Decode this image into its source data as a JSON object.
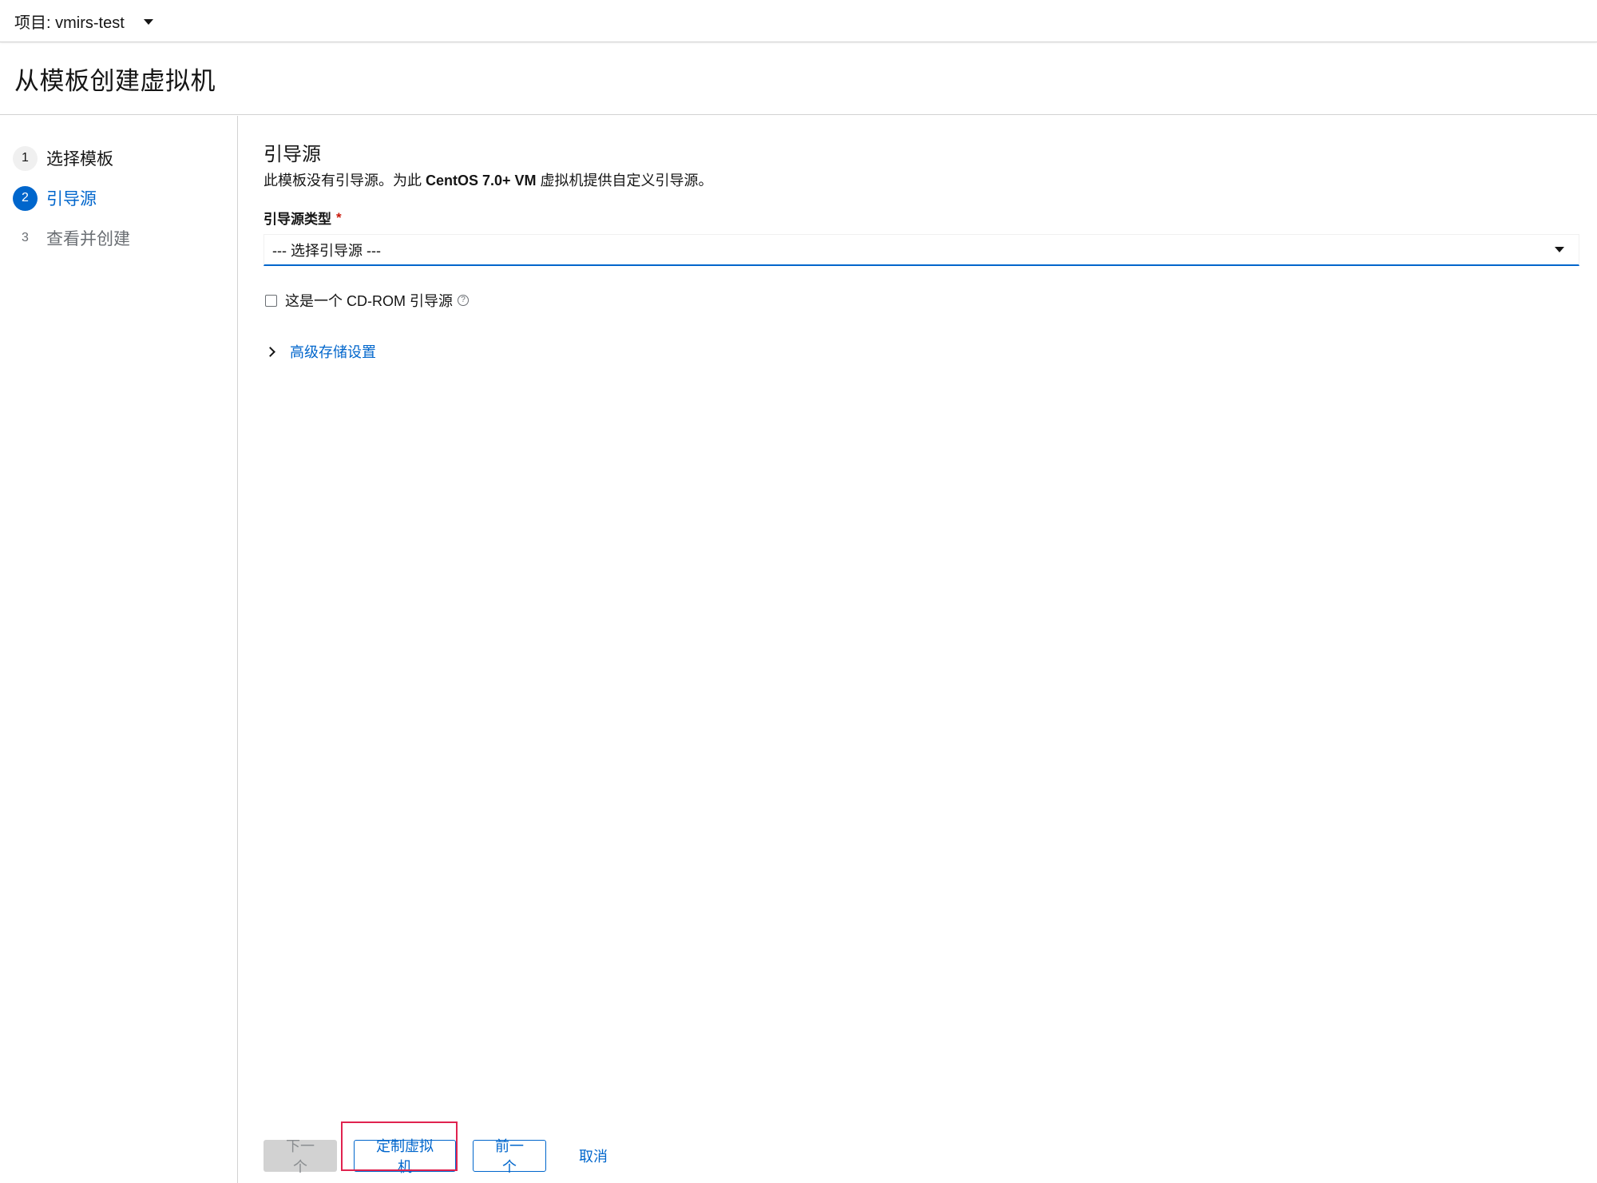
{
  "topbar": {
    "project_label": "项目: vmirs-test"
  },
  "page": {
    "title": "从模板创建虚拟机"
  },
  "wizard": {
    "steps": [
      {
        "number": "1",
        "label": "选择模板",
        "state": "default"
      },
      {
        "number": "2",
        "label": "引导源",
        "state": "active"
      },
      {
        "number": "3",
        "label": "查看并创建",
        "state": "disabled"
      }
    ]
  },
  "boot_source": {
    "title": "引导源",
    "description_prefix": "此模板没有引导源。为此 ",
    "description_bold": "CentOS 7.0+ VM",
    "description_suffix": " 虚拟机提供自定义引导源。",
    "type_label": "引导源类型",
    "required_marker": "*",
    "select_placeholder": "--- 选择引导源 ---",
    "cdrom_checkbox_label": "这是一个 CD-ROM 引导源",
    "cdrom_checked": false,
    "help_icon": "?",
    "advanced_storage_label": "高级存储设置"
  },
  "footer": {
    "next_label": "下一个",
    "customize_label": "定制虚拟机",
    "previous_label": "前一个",
    "cancel_label": "取消"
  },
  "colors": {
    "accent": "#0066cc",
    "highlight": "#e0234f",
    "required": "#c9190b"
  }
}
